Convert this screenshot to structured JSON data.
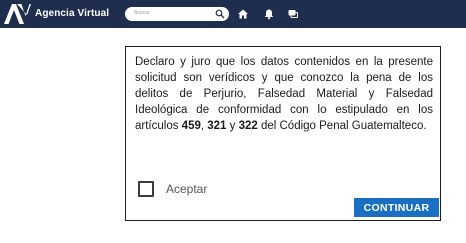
{
  "header": {
    "app_title": "Agencia Virtual",
    "search_placeholder": "Buscar",
    "icons": [
      "home-icon",
      "bell-icon",
      "chat-icon"
    ],
    "background_color": "#1f2d4e"
  },
  "dialog": {
    "declaration_part1": "Declaro y juro que los datos contenidos en la presente solicitud son verídicos y que conozco la pena de los delitos de Perjurio, Falsedad Material y Falsedad Ideológica de conformidad con lo estipulado en los artículos ",
    "article_1": "459",
    "sep_1": ", ",
    "article_2": "321",
    "sep_2": " y ",
    "article_3": "322",
    "declaration_part2": " del Código Penal Guatemalteco.",
    "accept_label": "Aceptar",
    "accept_checked": false,
    "continue_label": "CONTINUAR",
    "button_color": "#1b6fc2"
  }
}
